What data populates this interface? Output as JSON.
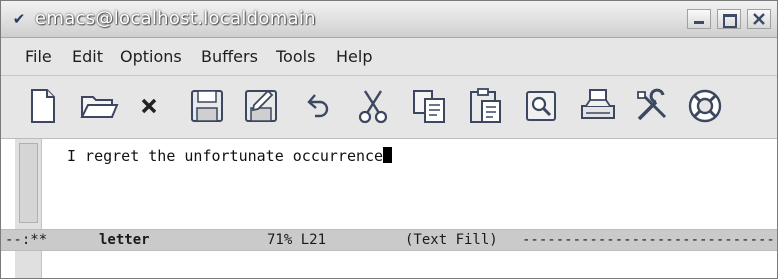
{
  "window": {
    "title": "emacs@localhost.localdomain",
    "controls": {
      "menu_glyph": "✔"
    }
  },
  "menubar": {
    "items": [
      "File",
      "Edit",
      "Options",
      "Buffers",
      "Tools",
      "Help"
    ]
  },
  "toolbar": {
    "tools": [
      "new-file-icon",
      "open-folder-icon",
      "close-icon",
      "save-icon",
      "save-as-icon",
      "undo-icon",
      "cut-icon",
      "copy-icon",
      "paste-icon",
      "search-icon",
      "print-icon",
      "customize-icon",
      "help-lifebuoy-icon"
    ]
  },
  "editor": {
    "text": "I regret the unfortunate occurrence"
  },
  "modeline": {
    "status": "--:**",
    "buffer_name": "letter",
    "position": "71% L21",
    "modes": "(Text Fill)",
    "fill": "--------------------------------"
  },
  "colors": {
    "title_text": "#ffffff",
    "chrome_bg": "#e6e6e6",
    "modeline_bg": "#cacaca",
    "icon_stroke": "#3c4760"
  }
}
